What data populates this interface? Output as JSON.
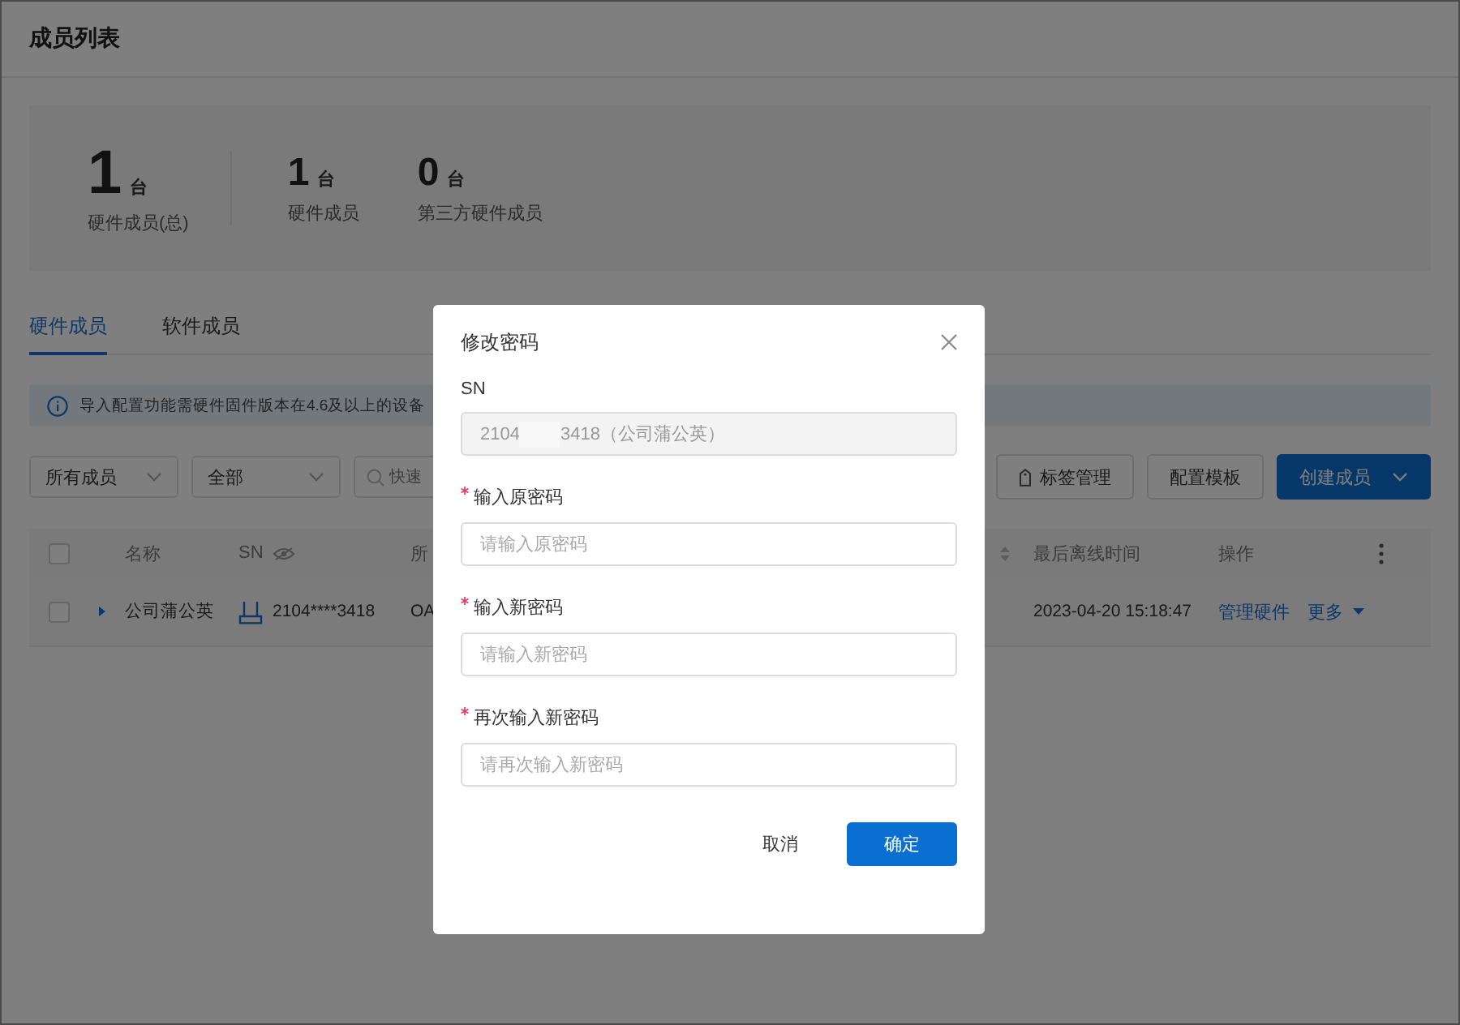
{
  "page": {
    "title": "成员列表"
  },
  "stats": [
    {
      "kind": "total",
      "value": "1",
      "unit": "台",
      "label": "硬件成员(总)"
    },
    {
      "kind": "count",
      "value": "1",
      "unit": "台",
      "label": "硬件成员"
    },
    {
      "kind": "count",
      "value": "0",
      "unit": "台",
      "label": "第三方硬件成员"
    }
  ],
  "tabs": [
    {
      "label": "硬件成员",
      "selected": true
    },
    {
      "label": "软件成员",
      "selected": false
    }
  ],
  "notice": "导入配置功能需硬件固件版本在4.6及以上的设备",
  "filters": [
    {
      "value": "所有成员"
    },
    {
      "value": "全部"
    }
  ],
  "search": {
    "placeholder": "快速"
  },
  "toolbar_buttons": [
    {
      "kind": "tag",
      "label": "标签管理"
    },
    {
      "kind": "plain",
      "label": "配置模板"
    },
    {
      "kind": "primary",
      "label": "创建成员"
    }
  ],
  "table": {
    "all_checked": false,
    "columns": [
      {
        "kind": "text",
        "label": "名称"
      },
      {
        "kind": "eye",
        "label": "SN"
      },
      {
        "kind": "sort",
        "label": "所"
      },
      {
        "kind": "text",
        "label": "最后离线时间"
      },
      {
        "kind": "text",
        "label": "操作"
      }
    ],
    "rows": [
      {
        "checked": false,
        "expanded": false,
        "name": "公司蒲公英",
        "sn": "2104****3418",
        "column_3": "OA",
        "last_offline": "2023-04-20 15:18:47",
        "actions": [
          "管理硬件",
          "更多"
        ]
      }
    ]
  },
  "dialog": {
    "title": "修改密码",
    "fields": [
      {
        "kind": "readonly",
        "label": "SN",
        "required": false,
        "value_start": "2104",
        "value_end": "3418（公司蒲公英）"
      },
      {
        "kind": "password",
        "label": "输入原密码",
        "required": true,
        "placeholder": "请输入原密码"
      },
      {
        "kind": "password",
        "label": "输入新密码",
        "required": true,
        "placeholder": "请输入新密码"
      },
      {
        "kind": "password",
        "label": "再次输入新密码",
        "required": true,
        "placeholder": "请再次输入新密码"
      }
    ],
    "buttons": [
      {
        "kind": "plain",
        "label": "取消"
      },
      {
        "kind": "primary",
        "label": "确定"
      }
    ]
  }
}
